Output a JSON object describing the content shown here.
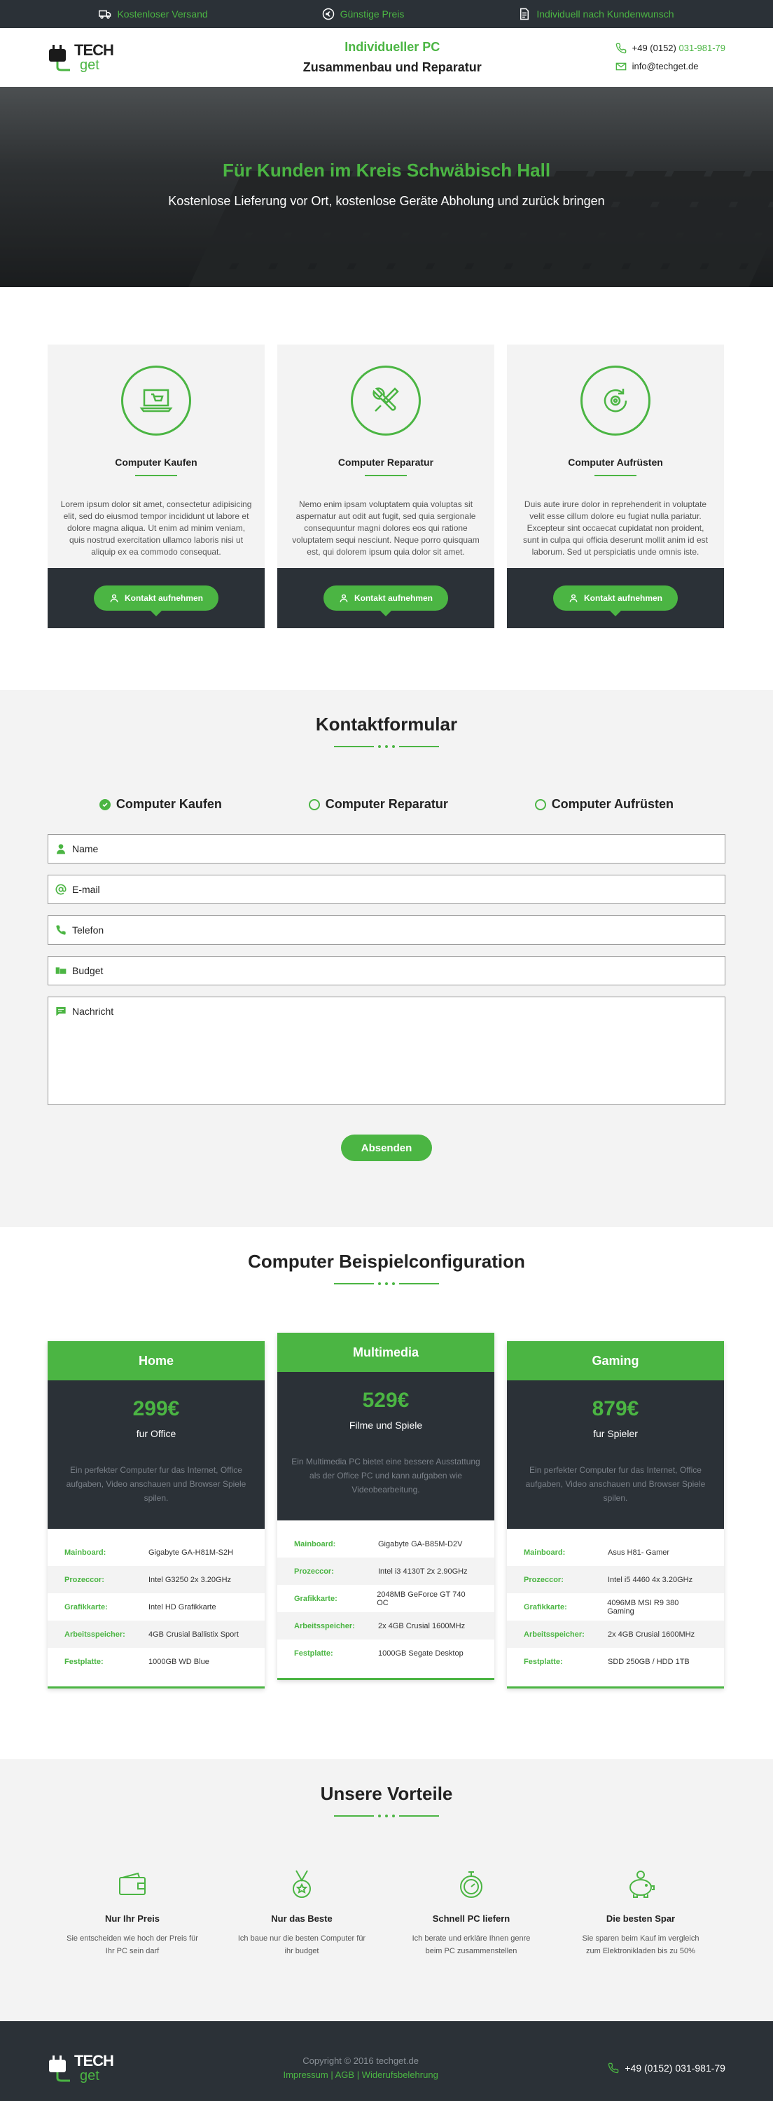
{
  "topbar": {
    "items": [
      {
        "label": "Kostenloser Versand",
        "icon": "truck-icon"
      },
      {
        "label": "Günstige Preis",
        "icon": "euro-icon"
      },
      {
        "label": "Individuell nach Kundenwunsch",
        "icon": "document-icon"
      }
    ]
  },
  "header": {
    "logo_top": "TECH",
    "logo_bottom": "get",
    "title_line1": "Individueller PC",
    "title_line2": "Zusammenbau und Reparatur",
    "phone_prefix": "+49 (0152) ",
    "phone_number": "031-981-79",
    "email": "info@techget.de"
  },
  "hero": {
    "title": "Für Kunden im Kreis Schwäbisch Hall",
    "subtitle": "Kostenlose Lieferung vor Ort, kostenlose Geräte Abholung und zurück bringen"
  },
  "services": [
    {
      "title": "Computer Kaufen",
      "text": "Lorem ipsum dolor sit amet, consectetur adipisicing elit, sed do eiusmod tempor incididunt ut labore et dolore magna aliqua. Ut enim ad minim veniam, quis nostrud exercitation ullamco laboris nisi ut  aliquip ex ea commodo consequat.",
      "button": "Kontakt aufnehmen",
      "icon": "laptop-cart-icon"
    },
    {
      "title": "Computer Reparatur",
      "text": "Nemo enim ipsam voluptatem quia voluptas sit aspernatur aut odit aut fugit, sed quia sergionale consequuntur magni dolores eos qui ratione voluptatem sequi nesciunt. Neque porro quisquam est, qui dolorem ipsum quia dolor sit amet.",
      "button": "Kontakt aufnehmen",
      "icon": "tools-icon"
    },
    {
      "title": "Computer Aufrüsten",
      "text": "Duis aute irure dolor in reprehenderit in voluptate velit esse cillum dolore eu fugiat nulla pariatur. Excepteur sint occaecat cupidatat non proident, sunt in culpa qui officia deserunt mollit anim id est laborum. Sed ut perspiciatis unde omnis iste.",
      "button": "Kontakt aufnehmen",
      "icon": "upgrade-gear-icon"
    }
  ],
  "form": {
    "title": "Kontaktformular",
    "options": [
      {
        "label": "Computer Kaufen",
        "selected": true
      },
      {
        "label": "Computer Reparatur",
        "selected": false
      },
      {
        "label": "Computer Aufrüsten",
        "selected": false
      }
    ],
    "fields": [
      {
        "placeholder": "Name",
        "icon": "user-icon"
      },
      {
        "placeholder": "E-mail",
        "icon": "at-icon"
      },
      {
        "placeholder": "Telefon",
        "icon": "phone-icon"
      },
      {
        "placeholder": "Budget",
        "icon": "money-icon"
      }
    ],
    "message_placeholder": "Nachricht",
    "submit": "Absenden"
  },
  "configs": {
    "title": "Computer Beispielconfiguration",
    "cards": [
      {
        "name": "Home",
        "price": "299€",
        "for": "fur Office",
        "desc": "Ein perfekter Computer fur das Internet, Office aufgaben, Video anschauen und Browser Spiele spilen.",
        "specs": [
          [
            "Mainboard:",
            "Gigabyte GA-H81M-S2H"
          ],
          [
            "Prozeccor:",
            "Intel G3250 2x 3.20GHz"
          ],
          [
            "Grafikkarte:",
            "Intel HD Grafikkarte"
          ],
          [
            "Arbeitsspeicher:",
            "4GB Crusial Ballistix Sport"
          ],
          [
            "Festplatte:",
            "1000GB WD Blue"
          ]
        ]
      },
      {
        "name": "Multimedia",
        "price": "529€",
        "for": "Filme und Spiele",
        "desc": "Ein Multimedia PC bietet eine bessere Ausstattung als der Office PC und kann aufgaben wie Videobearbeitung.",
        "specs": [
          [
            "Mainboard:",
            "Gigabyte GA-B85M-D2V"
          ],
          [
            "Prozeccor:",
            "Intel i3 4130T 2x 2.90GHz"
          ],
          [
            "Grafikkarte:",
            "2048MB GeForce GT 740 OC"
          ],
          [
            "Arbeitsspeicher:",
            "2x 4GB Crusial 1600MHz"
          ],
          [
            "Festplatte:",
            "1000GB Segate Desktop"
          ]
        ]
      },
      {
        "name": "Gaming",
        "price": "879€",
        "for": "fur Spieler",
        "desc": "Ein perfekter Computer fur das Internet, Office aufgaben, Video anschauen und Browser Spiele spilen.",
        "specs": [
          [
            "Mainboard:",
            "Asus H81- Gamer"
          ],
          [
            "Prozeccor:",
            "Intel i5 4460 4x 3.20GHz"
          ],
          [
            "Grafikkarte:",
            "4096MB MSI R9 380 Gaming"
          ],
          [
            "Arbeitsspeicher:",
            "2x 4GB Crusial 1600MHz"
          ],
          [
            "Festplatte:",
            "SDD 250GB / HDD 1TB"
          ]
        ]
      }
    ]
  },
  "advantages": {
    "title": "Unsere Vorteile",
    "items": [
      {
        "title": "Nur Ihr Preis",
        "text": "Sie entscheiden wie hoch der Preis für Ihr PC sein darf",
        "icon": "wallet-icon"
      },
      {
        "title": "Nur das Beste",
        "text": "Ich baue nur die besten Computer für ihr budget",
        "icon": "medal-icon"
      },
      {
        "title": "Schnell PC liefern",
        "text": "Ich berate und  erkläre Ihnen genre beim PC zusammenstellen",
        "icon": "stopwatch-icon"
      },
      {
        "title": "Die besten Spar",
        "text": "Sie sparen beim Kauf im vergleich zum Elektronikladen bis zu 50%",
        "icon": "piggy-bank-icon"
      }
    ]
  },
  "footer": {
    "copyright": "Copyright © 2016 techget.de",
    "links": "Impressum | AGB | Widerufsbelehrung",
    "phone_prefix": "+49 (0152) ",
    "phone_number": "031-981-79"
  },
  "colors": {
    "accent": "#4bb543",
    "dark": "#2b3137",
    "light": "#f3f3f3"
  }
}
